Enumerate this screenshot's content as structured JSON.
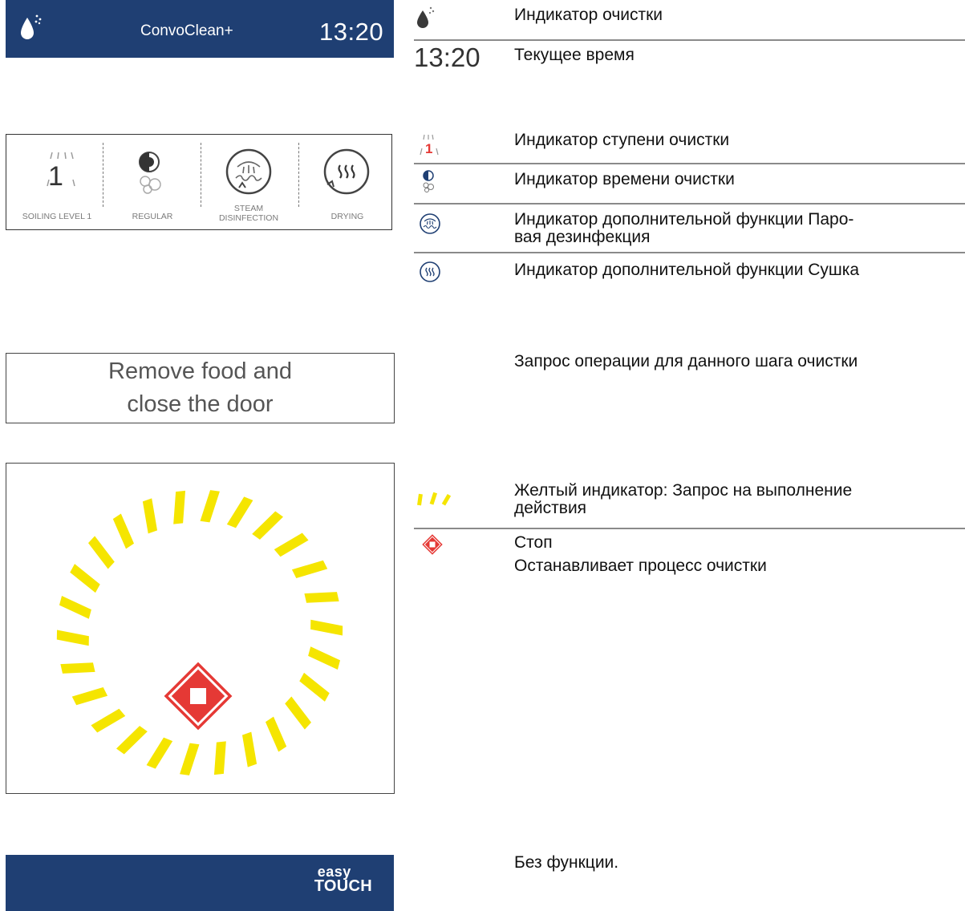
{
  "screen": {
    "app_title": "ConvoClean+",
    "clock": "13:20",
    "steps": [
      {
        "label": "SOILING LEVEL 1",
        "level": "1"
      },
      {
        "label": "REGULAR"
      },
      {
        "label_line1": "STEAM",
        "label_line2": "DISINFECTION"
      },
      {
        "label": "DRYING"
      }
    ],
    "message_line1": "Remove food and",
    "message_line2": "close the door",
    "footer_logo_top": "easy",
    "footer_logo_bottom": "TOUCH"
  },
  "legend": {
    "cleaning_indicator": "Индикатор очистки",
    "time_value": "13:20",
    "current_time": "Текущее время",
    "level_icon_digit": "1",
    "cleaning_level": "Индикатор ступени очистки",
    "cleaning_time": "Индикатор времени очистки",
    "steam_line1": "Индикатор дополнительной функции Паро-",
    "steam_line2": "вая дезинфекция",
    "drying": "Индикатор дополнительной функции Сушка",
    "request": "Запрос операции для данного шага очистки",
    "yellow_line1": "Желтый индикатор: Запрос на выполнение",
    "yellow_line2": "действия",
    "stop_title": "Стоп",
    "stop_desc": "Останавливает процесс очистки",
    "no_function": "Без функции."
  },
  "colors": {
    "header_blue": "#1f3f73",
    "indicator_yellow": "#f5e500",
    "stop_red": "#e53935",
    "level_red": "#e53935"
  },
  "icons": [
    "water-drop-icon",
    "soiling-level-icon",
    "regular-time-icon",
    "steam-disinfection-icon",
    "drying-icon",
    "yellow-indicator-icon",
    "stop-icon",
    "easy-touch-logo"
  ]
}
